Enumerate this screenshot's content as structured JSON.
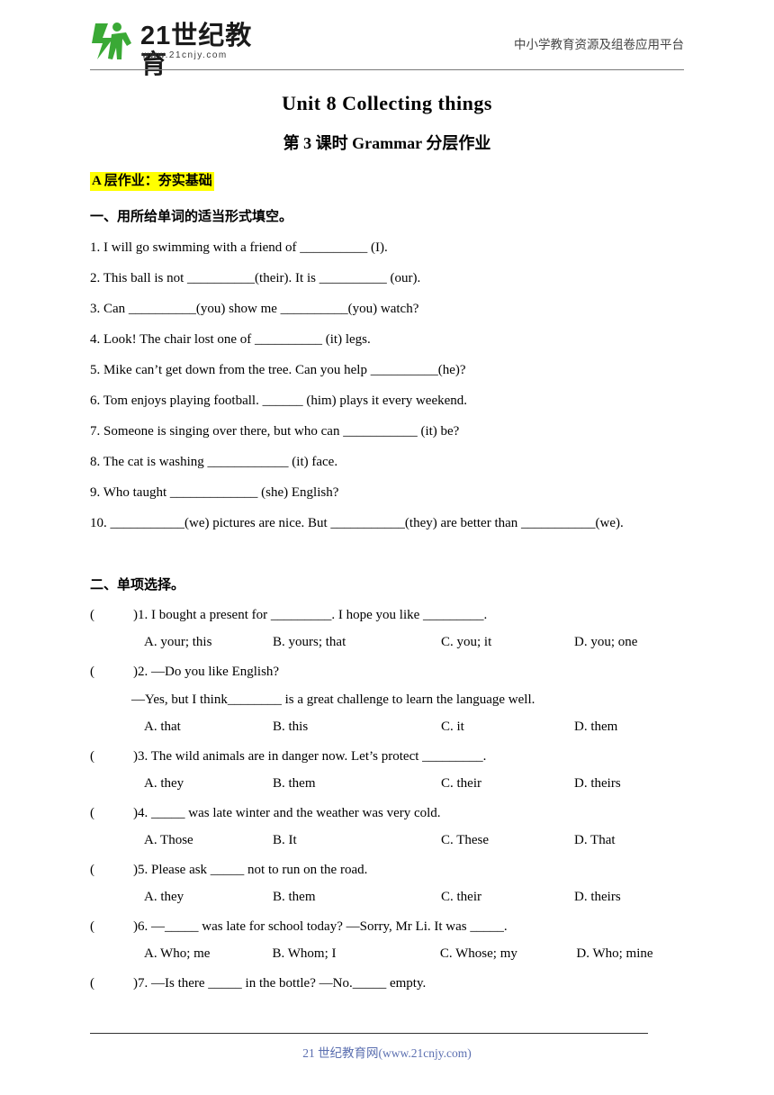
{
  "header": {
    "logo_text": "21世纪教育",
    "logo_sub": "www.21cnjy.com",
    "right_text": "中小学教育资源及组卷应用平台"
  },
  "title": "Unit 8 Collecting things",
  "subtitle": "第 3 课时  Grammar 分层作业",
  "section_a": "A 层作业：夯实基础",
  "part_one_heading": "一、用所给单词的适当形式填空。",
  "fill_items": [
    "1. I will go swimming with a friend of __________ (I).",
    "2. This ball is not __________(their). It is __________ (our).",
    "3. Can __________(you) show me __________(you) watch?",
    "4. Look! The chair lost one of __________   (it) legs.",
    "5. Mike can’t get down from the tree. Can you help __________(he)?",
    "6. Tom enjoys playing football. ______ (him) plays it every weekend.",
    "7. Someone is singing over there, but who can ___________   (it) be?",
    "8. The cat is washing ____________ (it) face.",
    "9. Who taught _____________ (she) English?",
    "10. ___________(we) pictures are nice. But ___________(they) are better than ___________(we)."
  ],
  "part_two_heading": "二、单项选择。",
  "mc_items": [
    {
      "paren": "(",
      "stem": ")1. I bought a present for _________. I hope you like _________.",
      "sub": "",
      "options": [
        "A. your; this",
        "B. yours; that",
        "C. you; it",
        "D. you; one"
      ]
    },
    {
      "paren": "(",
      "stem": ")2. —Do you like English?",
      "sub": "—Yes, but I think________ is a great challenge to learn the language well.",
      "options": [
        "A. that",
        "B. this",
        "C. it",
        "D. them"
      ]
    },
    {
      "paren": "(",
      "stem": ")3. The wild animals are in danger now. Let’s protect _________.",
      "sub": "",
      "options": [
        "A. they",
        "B. them",
        "C. their",
        "D. theirs"
      ]
    },
    {
      "paren": "(",
      "stem": ")4. _____ was late winter and the weather was very cold.",
      "sub": "",
      "options": [
        "A. Those",
        "B. It",
        "C. These",
        "D. That"
      ]
    },
    {
      "paren": "(",
      "stem": ")5. Please ask _____ not to run on the road.",
      "sub": "",
      "options": [
        "A. they",
        "B. them",
        "C. their",
        "D. theirs"
      ]
    },
    {
      "paren": "(",
      "stem": ")6. —_____ was late for school today?    —Sorry, Mr Li. It was _____.",
      "sub": "",
      "options": [
        "A. Who; me",
        "B. Whom; I",
        "C. Whose; my",
        "D. Who; mine"
      ]
    },
    {
      "paren": "(",
      "stem": ")7. —Is there _____ in the bottle?   —No._____ empty.",
      "sub": "",
      "options": []
    }
  ],
  "footer": {
    "text": "21 世纪教育网(www.21cnjy.com)"
  },
  "colors": {
    "highlight": "#ffff00",
    "footer_link": "#5b6fb0",
    "logo_green": "#3aa935"
  }
}
